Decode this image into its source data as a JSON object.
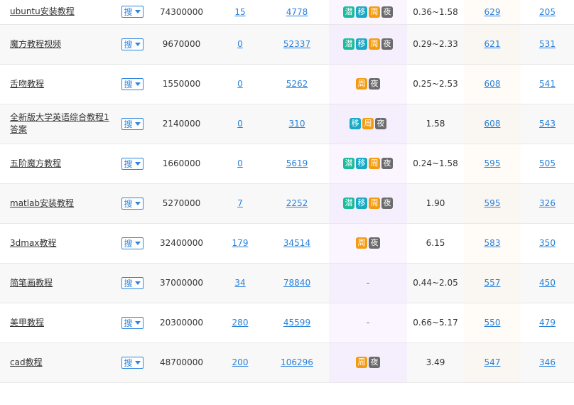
{
  "search_button_label": "搜",
  "badge_colors": {
    "潜": "#1bbc9b",
    "移": "#18a9c4",
    "周": "#f39c12",
    "夜": "#6b6b6b"
  },
  "rows": [
    {
      "keyword": "ubuntu安装教程",
      "index": "74300000",
      "a": "15",
      "b": "4778",
      "tags": [
        "潜",
        "移",
        "周",
        "夜"
      ],
      "range": "0.36~1.58",
      "s1": "629",
      "s2": "205"
    },
    {
      "keyword": "魔方教程视频",
      "index": "9670000",
      "a": "0",
      "b": "52337",
      "tags": [
        "潜",
        "移",
        "周",
        "夜"
      ],
      "range": "0.29~2.33",
      "s1": "621",
      "s2": "531"
    },
    {
      "keyword": "舌吻教程",
      "index": "1550000",
      "a": "0",
      "b": "5262",
      "tags": [
        "周",
        "夜"
      ],
      "range": "0.25~2.53",
      "s1": "608",
      "s2": "541"
    },
    {
      "keyword": "全新版大学英语综合教程1答案",
      "index": "2140000",
      "a": "0",
      "b": "310",
      "tags": [
        "移",
        "周",
        "夜"
      ],
      "range": "1.58",
      "s1": "608",
      "s2": "543"
    },
    {
      "keyword": "五阶魔方教程",
      "index": "1660000",
      "a": "0",
      "b": "5619",
      "tags": [
        "潜",
        "移",
        "周",
        "夜"
      ],
      "range": "0.24~1.58",
      "s1": "595",
      "s2": "505"
    },
    {
      "keyword": "matlab安装教程",
      "index": "5270000",
      "a": "7",
      "b": "2252",
      "tags": [
        "潜",
        "移",
        "周",
        "夜"
      ],
      "range": "1.90",
      "s1": "595",
      "s2": "326"
    },
    {
      "keyword": "3dmax教程",
      "index": "32400000",
      "a": "179",
      "b": "34514",
      "tags": [
        "周",
        "夜"
      ],
      "range": "6.15",
      "s1": "583",
      "s2": "350"
    },
    {
      "keyword": "简笔画教程",
      "index": "37000000",
      "a": "34",
      "b": "78840",
      "tags": [],
      "tag_placeholder": "-",
      "range": "0.44~2.05",
      "s1": "557",
      "s2": "450"
    },
    {
      "keyword": "美甲教程",
      "index": "20300000",
      "a": "280",
      "b": "45599",
      "tags": [],
      "tag_placeholder": "-",
      "range": "0.66~5.17",
      "s1": "550",
      "s2": "479"
    },
    {
      "keyword": "cad教程",
      "index": "48700000",
      "a": "200",
      "b": "106296",
      "tags": [
        "周",
        "夜"
      ],
      "range": "3.49",
      "s1": "547",
      "s2": "346"
    }
  ]
}
